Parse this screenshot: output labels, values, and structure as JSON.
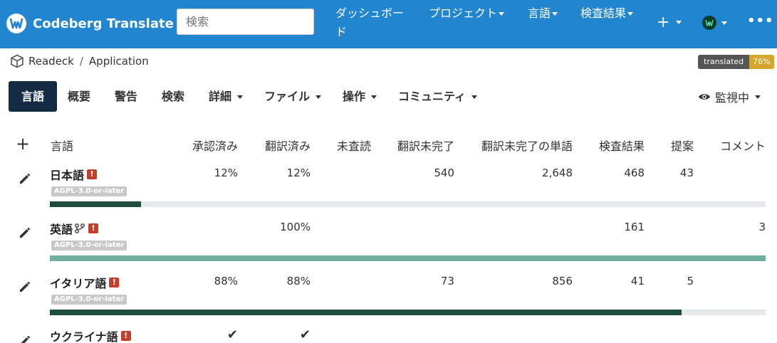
{
  "navbar": {
    "brand": "Codeberg Translate",
    "search_placeholder": "検索",
    "dashboard": "ダッシュボード",
    "projects": "プロジェクト",
    "languages": "言語",
    "checks": "検査結果",
    "add": "+",
    "more": "•••"
  },
  "breadcrumb": {
    "project": "Readeck",
    "sep": "/",
    "component": "Application"
  },
  "badge": {
    "label": "translated",
    "value": "76%"
  },
  "tabs": [
    "言語",
    "概要",
    "警告",
    "検索",
    "詳細",
    "ファイル",
    "操作",
    "コミュニティ"
  ],
  "watch_label": "監視中",
  "table": {
    "headers": {
      "language": "言語",
      "approved": "承認済み",
      "translated": "翻訳済み",
      "unreviewed": "未査読",
      "untranslated": "翻訳未完了",
      "untranslated_words": "翻訳未完了の単語",
      "checks": "検査結果",
      "suggestions": "提案",
      "comments": "コメント"
    },
    "rows": [
      {
        "name": "日本語",
        "license": "AGPL-3.0-or-later",
        "approved": "12%",
        "translated": "12%",
        "untranslated": "540",
        "untranslated_words": "2,648",
        "checks": "468",
        "suggestions": "43",
        "comments": "",
        "progress": 0.127,
        "bar_color": "#1e4d3c"
      },
      {
        "name": "英語",
        "license": "AGPL-3.0-or-later",
        "approved": "",
        "translated": "100%",
        "untranslated": "",
        "untranslated_words": "",
        "checks": "161",
        "suggestions": "",
        "comments": "3",
        "progress": 1.0,
        "bar_color": "#6fae9d"
      },
      {
        "name": "イタリア語",
        "license": "AGPL-3.0-or-later",
        "approved": "88%",
        "translated": "88%",
        "untranslated": "73",
        "untranslated_words": "856",
        "checks": "41",
        "suggestions": "5",
        "comments": "",
        "progress": 0.883,
        "bar_color": "#1e4d3c"
      },
      {
        "name": "ウクライナ語",
        "approved": "✔",
        "translated": "✔"
      }
    ]
  },
  "icons": {
    "logo": "codeberg-translate-logo-icon",
    "edit": "pencil-icon",
    "source": "source-branch-icon",
    "alert": "alert-icon",
    "eye": "eye-icon",
    "avatar": "user-avatar-icon",
    "project": "cube-icon"
  }
}
